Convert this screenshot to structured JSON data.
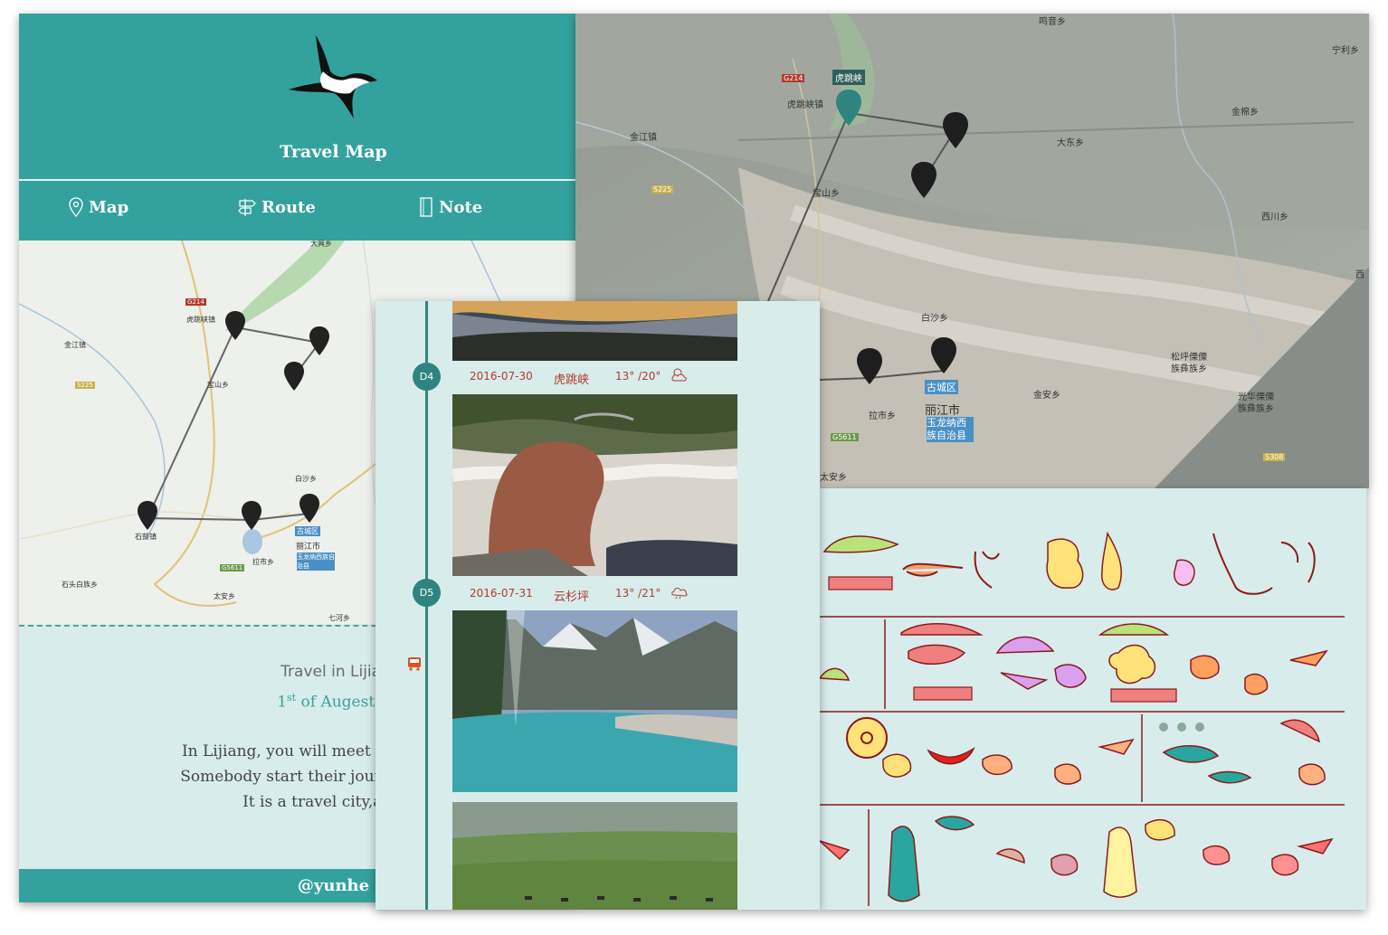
{
  "left_panel": {
    "title": "Travel Map",
    "nav": [
      {
        "label": "Map",
        "icon": "map-pin-icon"
      },
      {
        "label": "Route",
        "icon": "signpost-icon"
      },
      {
        "label": "Note",
        "icon": "note-icon"
      }
    ],
    "map_labels": [
      "大具乡",
      "虎跳峡镇",
      "宝山乡",
      "金江镇",
      "石鼓镇",
      "石头白族乡",
      "白沙乡",
      "古城区",
      "丽江市",
      "玉龙纳西族自治县",
      "太安乡",
      "七河乡",
      "拉市乡",
      "G214",
      "G5611",
      "S225"
    ],
    "story": {
      "subtitle": "Travel in Lijian",
      "date_prefix": "1",
      "date_sup": "st",
      "date_rest": " of Augest, 2",
      "body_lines": [
        "In Lijiang, you will meet nice people, m",
        "Somebody start their journey here, som",
        "It is a travel city,and als"
      ]
    },
    "footer": "@yunhe"
  },
  "top_right_map": {
    "active_label": "虎跳峡",
    "labels": [
      "鸣音乡",
      "宁利乡",
      "G214",
      "虎跳峡镇",
      "金江镇",
      "金棉乡",
      "大东乡",
      "S225",
      "宝山乡",
      "西川乡",
      "白沙乡",
      "古城区",
      "丽江市",
      "玉龙纳西族自治县",
      "拉市乡",
      "金安乡",
      "松坪傈僳族彝族乡",
      "光华傈僳族彝族乡",
      "G5611",
      "太安乡",
      "S308",
      "西"
    ]
  },
  "timeline": {
    "days": [
      {
        "badge": "D4",
        "date": "2016-07-30",
        "place": "虎跳峡",
        "temp": "13° /20°",
        "weather_icon": "partly-cloudy-icon"
      },
      {
        "badge": "D5",
        "date": "2016-07-31",
        "place": "云杉坪",
        "temp": "13° /21°",
        "weather_icon": "rain-cloud-icon"
      }
    ]
  },
  "colors": {
    "teal": "#33a29e",
    "teal_dark": "#2f8480",
    "panel_bg": "#d8ecec",
    "accent_red": "#b03a2e"
  }
}
